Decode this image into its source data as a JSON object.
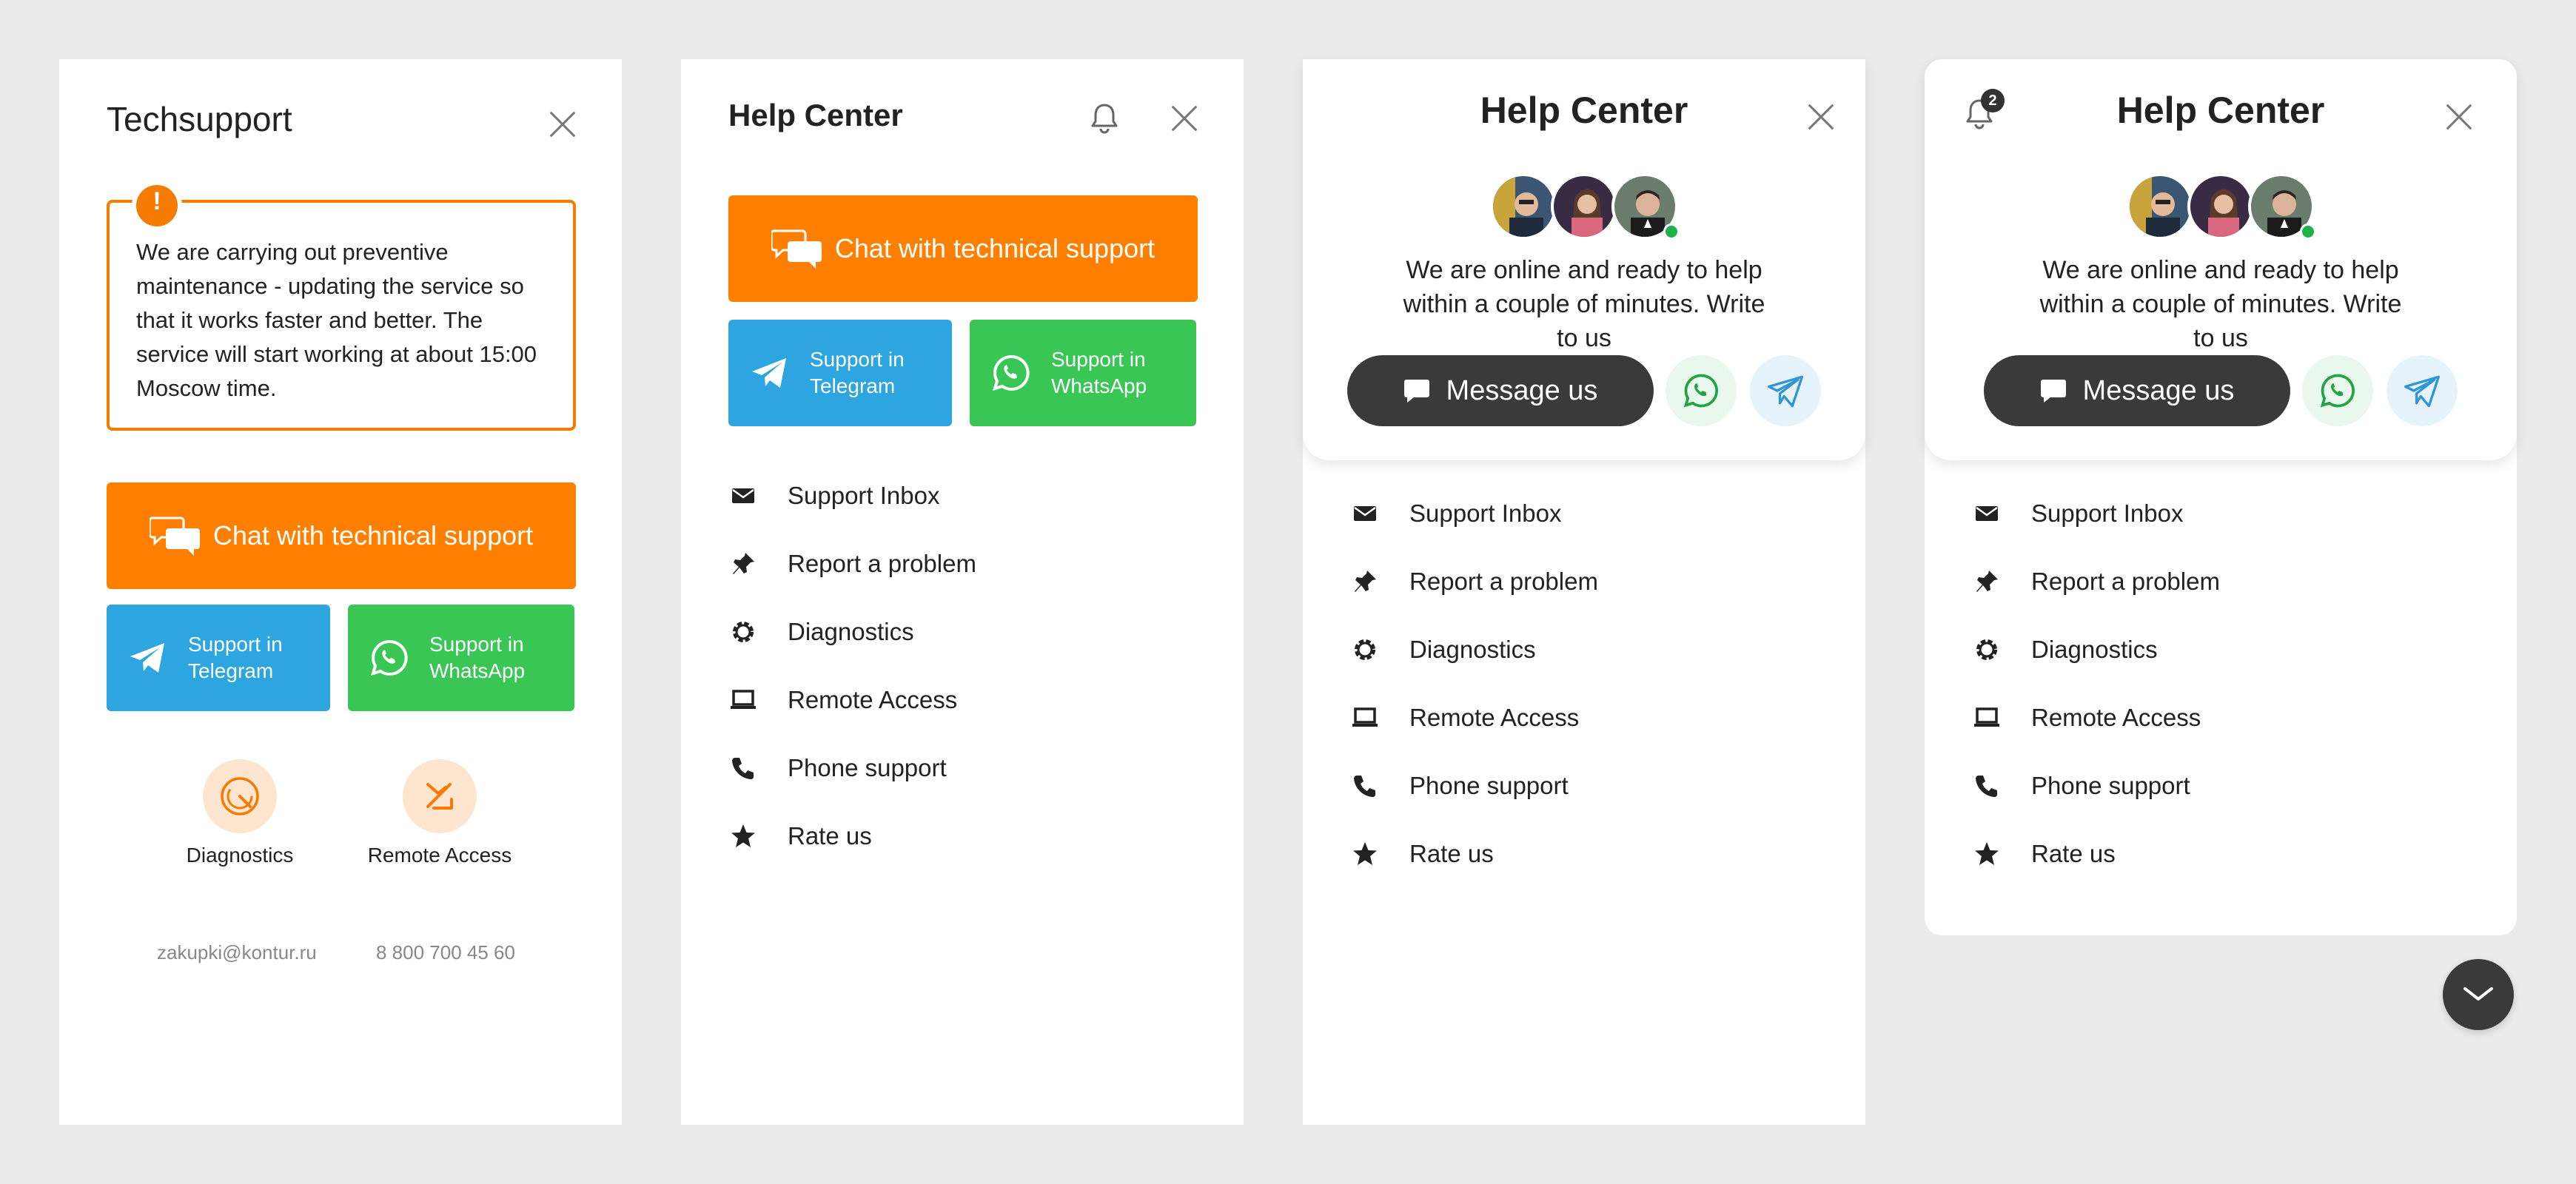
{
  "techsupport": {
    "title": "Techsupport",
    "notice": "We are carrying out preventive maintenance - updating the service so that it works faster and better. The service will start working at about 15:00 Moscow time.",
    "notice_badge": "!",
    "chat_button": "Chat with technical support",
    "telegram_button": "Support in Telegram",
    "whatsapp_button": "Support in WhatsApp",
    "diagnostics_label": "Diagnostics",
    "remote_access_label": "Remote Access",
    "email": "zakupki@kontur.ru",
    "phone": "8 800 700 45 60"
  },
  "help_center_classic": {
    "title": "Help Center",
    "chat_button": "Chat with technical support",
    "telegram_button": "Support in Telegram",
    "whatsapp_button": "Support in WhatsApp"
  },
  "help_center_modern": {
    "title": "Help Center",
    "online_text": "We are online and ready to help within a couple of minutes. Write to us",
    "message_button": "Message us",
    "notification_count": "2"
  },
  "menu": [
    {
      "label": "Support Inbox",
      "icon": "envelope-icon"
    },
    {
      "label": "Report a problem",
      "icon": "pin-icon"
    },
    {
      "label": "Diagnostics",
      "icon": "gear-icon"
    },
    {
      "label": "Remote Access",
      "icon": "laptop-icon"
    },
    {
      "label": "Phone support",
      "icon": "phone-icon"
    },
    {
      "label": "Rate us",
      "icon": "star-icon"
    }
  ],
  "colors": {
    "orange": "#ff7f00",
    "telegram": "#2da5e0",
    "whatsapp": "#3ac655",
    "dark": "#3a3a3a",
    "online": "#1fb14a"
  }
}
